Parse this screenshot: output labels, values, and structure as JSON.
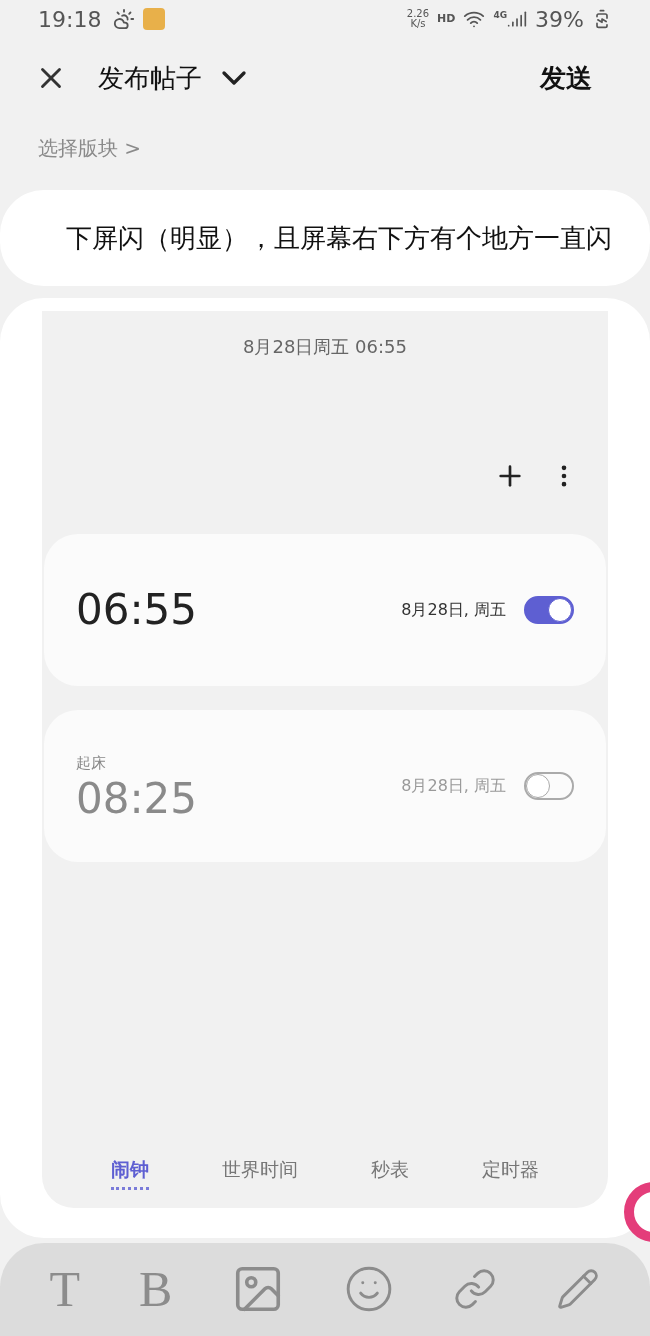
{
  "status_bar": {
    "time": "19:18",
    "speed_value": "2.26",
    "speed_unit": "K/s",
    "hd": "HD",
    "network": "4G",
    "battery": "39%"
  },
  "header": {
    "title": "发布帖子",
    "send": "发送"
  },
  "section_picker": "选择版块 >",
  "editor": {
    "text": "下屏闪（明显），且屏幕右下方有个地方一直闪"
  },
  "embedded_screenshot": {
    "subtitle": "8月28日周五 06:55",
    "alarms": [
      {
        "time": "06:55",
        "date": "8月28日, 周五",
        "on": true
      },
      {
        "label": "起床",
        "time": "08:25",
        "date": "8月28日, 周五",
        "on": false
      }
    ],
    "tabs": [
      {
        "label": "闹钟",
        "selected": true
      },
      {
        "label": "世界时间",
        "selected": false
      },
      {
        "label": "秒表",
        "selected": false
      },
      {
        "label": "定时器",
        "selected": false
      }
    ]
  },
  "toolbar": [
    {
      "kind": "text",
      "label": "T"
    },
    {
      "kind": "text",
      "label": "B"
    },
    {
      "kind": "image"
    },
    {
      "kind": "emoji"
    },
    {
      "kind": "link"
    },
    {
      "kind": "pen"
    }
  ]
}
